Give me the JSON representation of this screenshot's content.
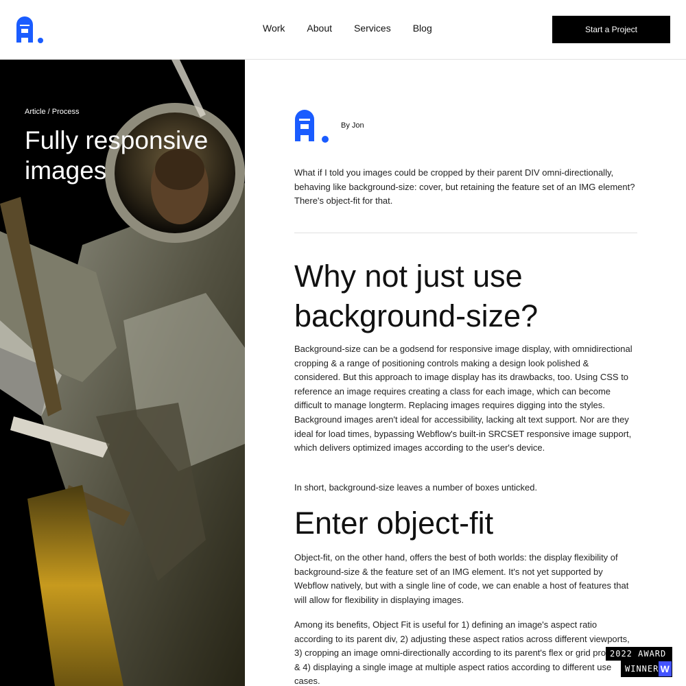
{
  "header": {
    "nav": [
      {
        "label": "Work"
      },
      {
        "label": "About"
      },
      {
        "label": "Services"
      },
      {
        "label": "Blog"
      }
    ],
    "cta_label": "Start a Project"
  },
  "hero": {
    "breadcrumb": "Article / Process",
    "title": "Fully responsive images",
    "image_icon": "astronaut-photo"
  },
  "article": {
    "author": "By Jon",
    "intro": "What if I told you images could be cropped by their parent DIV omni-directionally, behaving like background-size: cover, but retaining the feature set of an IMG element? There's object-fit for that.",
    "heading1": "Why not just use background-size?",
    "para1": "Background-size can be a godsend for responsive image display, with omnidirectional cropping & a range of positioning controls making a design look polished & considered. But this approach to image display has its drawbacks, too. Using CSS to reference an image requires creating a class for each image, which can become difficult to manage longterm. Replacing images requires digging into the styles. Background images aren't ideal for accessibility, lacking alt text support. Nor are they ideal for load times, bypassing Webflow's built-in SRCSET responsive image support, which delivers optimized images according to the user's device.",
    "para2": "In short, background-size leaves a number of boxes unticked.",
    "heading2": "Enter object-fit",
    "para3": "Object-fit, on the other hand, offers the best of both worlds: the display flexibility of background-size & the feature set of an IMG element. It's not yet supported by Webflow natively, but with a single line of code, we can enable a host of features that will allow for flexibility in displaying images.",
    "para4": "Among its benefits, Object Fit is useful for 1) defining an image's aspect ratio according to its parent div, 2) adjusting these aspect ratios across different viewports, 3) cropping an image omni-directionally according to its parent's flex or grid properties, & 4) displaying a single image at multiple aspect ratios according to different use cases."
  },
  "badge": {
    "line1": "2022 AWARD",
    "line2": "WINNER",
    "logo_letter": "W"
  },
  "colors": {
    "brand_blue": "#1a5cff",
    "webflow_blue": "#4353ff"
  }
}
